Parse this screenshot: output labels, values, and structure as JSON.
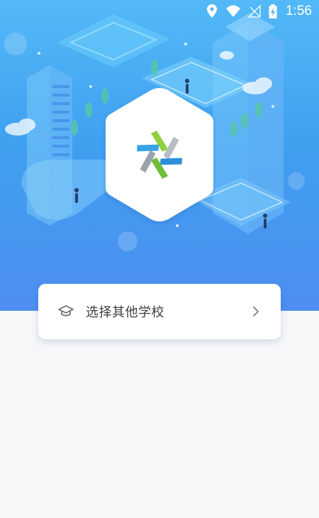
{
  "status_bar": {
    "time": "1:56",
    "icons": [
      "location-icon",
      "wifi-icon",
      "no-signal-icon",
      "battery-charging-icon"
    ]
  },
  "hero": {
    "illustration": "isometric-campus-illustration",
    "logo": "school-star-logo"
  },
  "school_selector": {
    "label": "选择其他学校",
    "icon": "graduation-cap-icon",
    "trailing_icon": "chevron-right-icon"
  },
  "colors": {
    "hero_top": "#53b9f7",
    "hero_bottom": "#4e8ef0",
    "page_background": "#f6f7f9",
    "card_background": "#ffffff",
    "label_text": "#3d3d3d",
    "icon_gray": "#6b6f7a"
  }
}
